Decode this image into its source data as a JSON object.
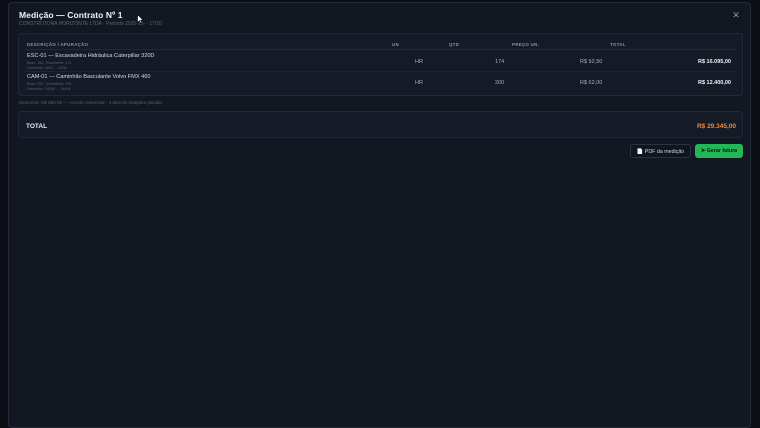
{
  "modal": {
    "title": "Medição — Contrato Nº 1",
    "subtitle": "CONSTRUTORA HORIZONTE LTDA · Período 2025-10-  · 17/10",
    "close_icon": "close-icon"
  },
  "table": {
    "headers": [
      "DESCRIÇÃO / APURAÇÃO",
      "UN",
      "QTD",
      "PREÇO UN.",
      "TOTAL"
    ],
    "rows": [
      {
        "name": "ESC-01 — Escavadeira Hidráulica Caterpillar 320D",
        "meta1": "Base: 164 · Excedente: 174",
        "meta2": "Horímetro: 4832 → 5006",
        "un": "HR",
        "qtd": "174",
        "price": "R$ 92,50",
        "total": "R$ 16.095,00"
      },
      {
        "name": "CAM-01 — Caminhão Basculante Volvo FMX 460",
        "meta1": "Base: 200 · Excedente: 200",
        "meta2": "Horímetro: 34208 → 34408",
        "un": "HR",
        "qtd": "200",
        "price": "R$ 62,00",
        "total": "R$ 12.400,00"
      }
    ]
  },
  "note": "Desconto: R$ 850,00 — Acordo comercial - 4 dias de máquina parada",
  "summary": {
    "label": "TOTAL",
    "value": "R$ 29.345,00",
    "value_color": "#f08a2c"
  },
  "actions": {
    "pdf_label": "📄 PDF da medição",
    "fatura_label": "➤ Gerar fatura",
    "accent": "#22b857"
  }
}
